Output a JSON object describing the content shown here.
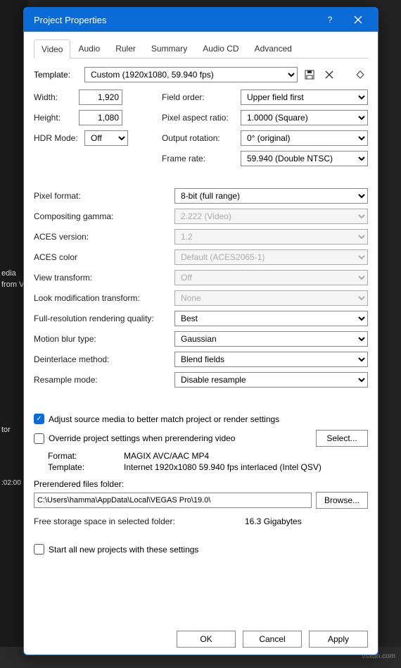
{
  "titlebar": {
    "title": "Project Properties"
  },
  "tabs": [
    "Video",
    "Audio",
    "Ruler",
    "Summary",
    "Audio CD",
    "Advanced"
  ],
  "template": {
    "label": "Template:",
    "value": "Custom (1920x1080, 59.940 fps)"
  },
  "video": {
    "width_label": "Width:",
    "width_value": "1,920",
    "height_label": "Height:",
    "height_value": "1,080",
    "hdr_label": "HDR Mode:",
    "hdr_value": "Off",
    "field_order_label": "Field order:",
    "field_order_value": "Upper field first",
    "par_label": "Pixel aspect ratio:",
    "par_value": "1.0000 (Square)",
    "rotation_label": "Output rotation:",
    "rotation_value": "0° (original)",
    "fps_label": "Frame rate:",
    "fps_value": "59.940 (Double NTSC)"
  },
  "format": {
    "pixel_format_label": "Pixel format:",
    "pixel_format_value": "8-bit (full range)",
    "gamma_label": "Compositing gamma:",
    "gamma_value": "2.222 (Video)",
    "aces_ver_label": "ACES version:",
    "aces_ver_value": "1.2",
    "aces_color_label": "ACES color",
    "aces_color_value": "Default (ACES2065-1)",
    "view_xform_label": "View transform:",
    "view_xform_value": "Off",
    "look_label": "Look modification transform:",
    "look_value": "None",
    "render_q_label": "Full-resolution rendering quality:",
    "render_q_value": "Best",
    "motion_blur_label": "Motion blur type:",
    "motion_blur_value": "Gaussian",
    "deint_label": "Deinterlace method:",
    "deint_value": "Blend fields",
    "resample_label": "Resample mode:",
    "resample_value": "Disable resample"
  },
  "checks": {
    "adjust_source": "Adjust source media to better match project or render settings",
    "override": "Override project settings when prerendering video",
    "select_btn": "Select...",
    "start_all": "Start all new projects with these settings"
  },
  "prerender": {
    "format_label": "Format:",
    "format_value": "MAGIX AVC/AAC MP4",
    "template_label": "Template:",
    "template_value": "Internet 1920x1080 59.940 fps interlaced (Intel QSV)",
    "folder_label": "Prerendered files folder:",
    "folder_value": "C:\\Users\\hamma\\AppData\\Local\\VEGAS Pro\\19.0\\",
    "browse": "Browse...",
    "freespace_label": "Free storage space in selected folder:",
    "freespace_value": "16.3 Gigabytes"
  },
  "buttons": {
    "ok": "OK",
    "cancel": "Cancel",
    "apply": "Apply"
  },
  "bg": {
    "timecode": ":02:00",
    "media": "edia",
    "from": "from V",
    "tor": "tor",
    "watermark": "vsxdn.com"
  }
}
